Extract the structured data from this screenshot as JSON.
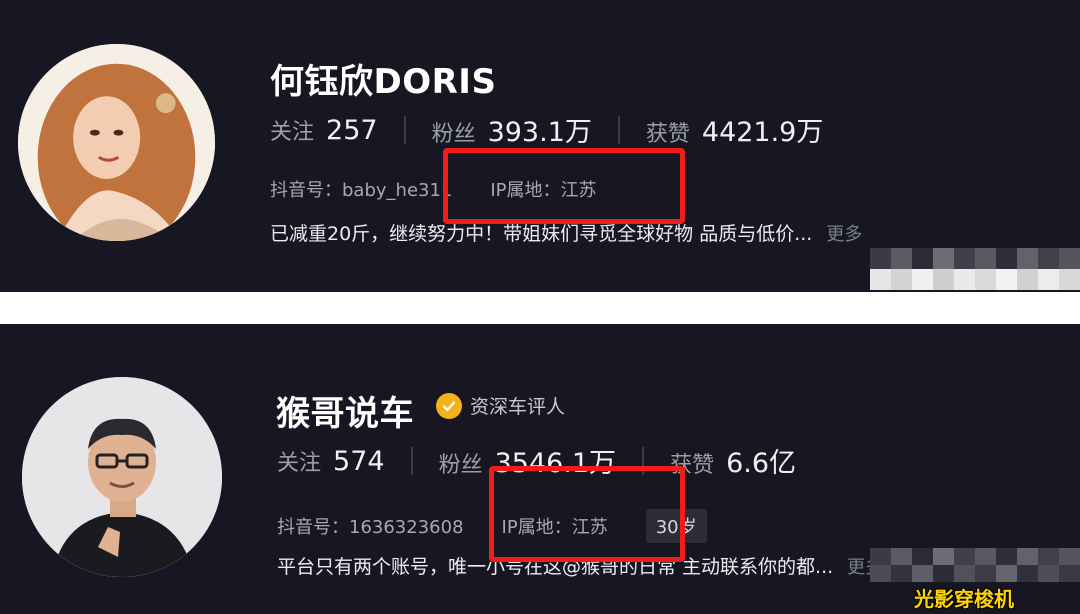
{
  "profiles": [
    {
      "name": "何钰欣DORIS",
      "stats": [
        {
          "label": "关注",
          "value": "257"
        },
        {
          "label": "粉丝",
          "value": "393.1万"
        },
        {
          "label": "获赞",
          "value": "4421.9万"
        }
      ],
      "douyin_id": "抖音号：baby_he311",
      "ip_location": "IP属地：江苏",
      "bio": "已减重20斤，继续努力中！带姐妹们寻觅全球好物 品质与低价...",
      "more": "更多"
    },
    {
      "name": "猴哥说车",
      "verified_label": "资深车评人",
      "stats": [
        {
          "label": "关注",
          "value": "574"
        },
        {
          "label": "粉丝",
          "value": "3546.1万"
        },
        {
          "label": "获赞",
          "value": "6.6亿"
        }
      ],
      "douyin_id": "抖音号：1636323608",
      "ip_location": "IP属地：江苏",
      "age": "30岁",
      "bio": "平台只有两个账号，唯一小号在这@猴哥的日常 主动联系你的都...",
      "more": "更多"
    }
  ],
  "colors": {
    "background": "#161723",
    "highlight": "#f01d1d",
    "verified_badge": "#f3b21a"
  },
  "watermark": "光影穿梭机",
  "icons": [
    "verified-check-icon"
  ]
}
